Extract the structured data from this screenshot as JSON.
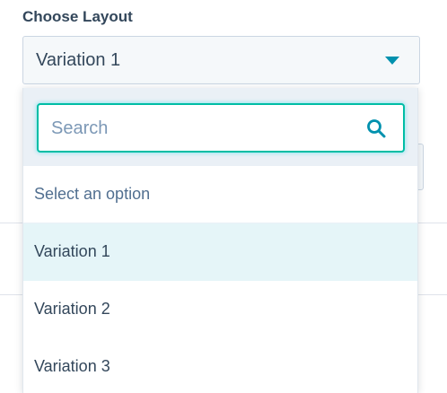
{
  "field": {
    "label": "Choose Layout",
    "selected_value": "Variation 1"
  },
  "search": {
    "placeholder": "Search",
    "value": ""
  },
  "options": [
    {
      "label": "Select an option",
      "state": "placeholder"
    },
    {
      "label": "Variation 1",
      "state": "selected"
    },
    {
      "label": "Variation 2",
      "state": "default"
    },
    {
      "label": "Variation 3",
      "state": "default"
    }
  ],
  "icons": {
    "caret": "caret-down-icon",
    "search": "search-icon"
  },
  "colors": {
    "accent": "#0091ae",
    "focus_border": "#00bda5",
    "selected_bg": "#e5f5f8",
    "text": "#33475b"
  }
}
